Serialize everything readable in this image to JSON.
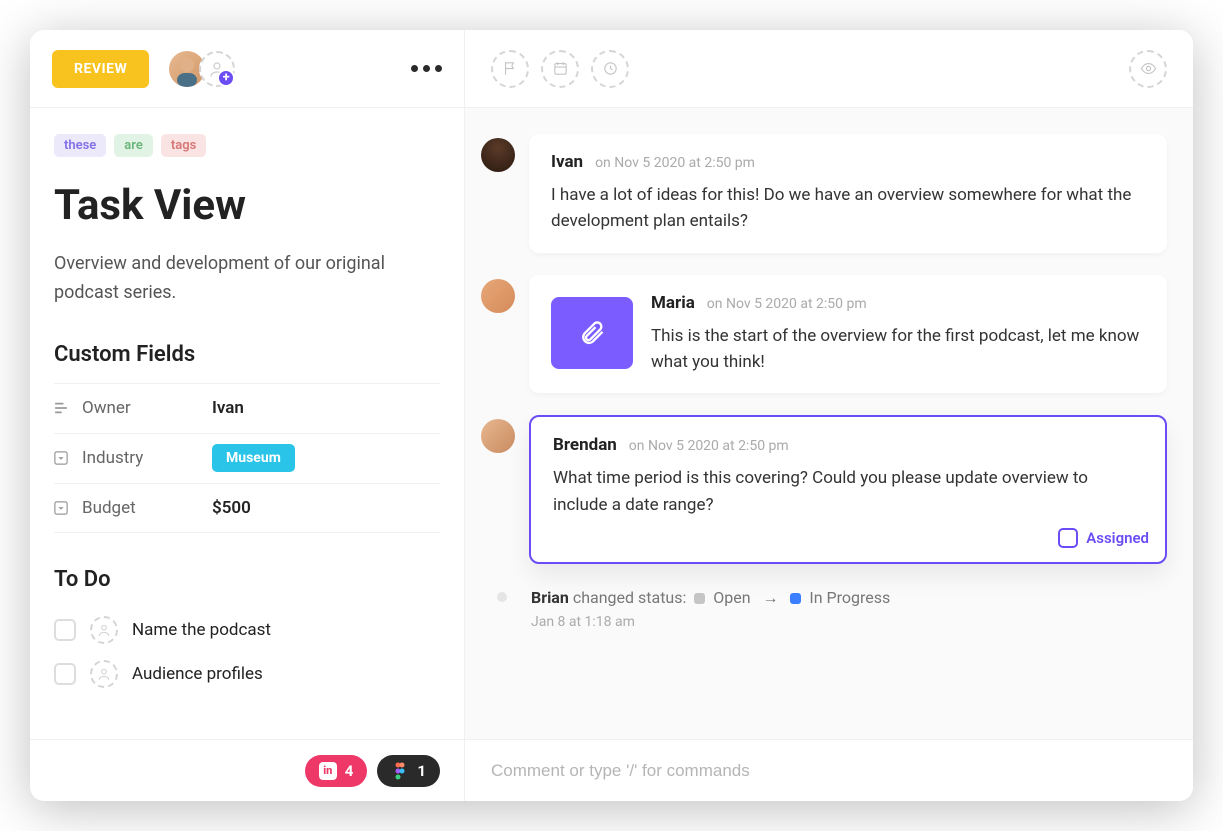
{
  "header": {
    "status": "REVIEW"
  },
  "tags": [
    "these",
    "are",
    "tags"
  ],
  "title": "Task View",
  "description": "Overview and development of our original podcast series.",
  "custom_fields": {
    "heading": "Custom Fields",
    "rows": [
      {
        "label": "Owner",
        "value": "Ivan",
        "type": "text"
      },
      {
        "label": "Industry",
        "value": "Museum",
        "type": "tag"
      },
      {
        "label": "Budget",
        "value": "$500",
        "type": "text"
      }
    ]
  },
  "todo": {
    "heading": "To Do",
    "items": [
      {
        "text": "Name the podcast"
      },
      {
        "text": "Audience profiles"
      }
    ]
  },
  "integrations": [
    {
      "name": "InVision",
      "count": "4"
    },
    {
      "name": "Figma",
      "count": "1"
    }
  ],
  "comments": [
    {
      "author": "Ivan",
      "meta": "on Nov 5 2020 at 2:50 pm",
      "body": "I have a lot of ideas for this! Do we have an overview somewhere for what the development plan entails?"
    },
    {
      "author": "Maria",
      "meta": "on Nov 5 2020 at 2:50 pm",
      "body": "This is the start of the overview for the first podcast, let me know what you think!",
      "attachment": true
    },
    {
      "author": "Brendan",
      "meta": "on Nov 5 2020 at 2:50 pm",
      "body": "What time period is this covering? Could you please update overview to include a date range?",
      "assigned_label": "Assigned",
      "highlighted": true
    }
  ],
  "activity": {
    "actor": "Brian",
    "action": "changed status:",
    "from": "Open",
    "to": "In Progress",
    "time": "Jan 8 at 1:18 am"
  },
  "composer": {
    "placeholder": "Comment or type '/' for commands"
  }
}
